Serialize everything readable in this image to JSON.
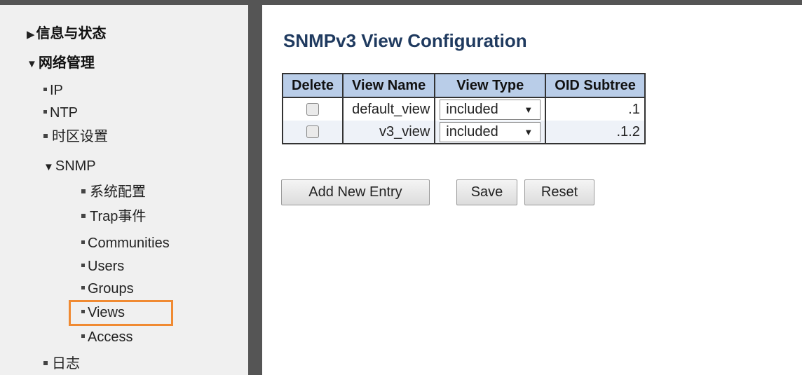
{
  "sidebar": {
    "items": [
      {
        "label": "信息与状态",
        "marker": "▶"
      },
      {
        "label": "网络管理",
        "marker": "▼"
      },
      {
        "label": "IP"
      },
      {
        "label": "NTP"
      },
      {
        "label": "时区设置"
      },
      {
        "label": "SNMP",
        "marker": "▼"
      },
      {
        "label": "系统配置"
      },
      {
        "label": "Trap事件"
      },
      {
        "label": "Communities"
      },
      {
        "label": "Users"
      },
      {
        "label": "Groups"
      },
      {
        "label": "Views",
        "selected": true
      },
      {
        "label": "Access"
      },
      {
        "label": "日志"
      }
    ]
  },
  "main": {
    "title": "SNMPv3 View Configuration",
    "table": {
      "headers": [
        "Delete",
        "View Name",
        "View Type",
        "OID Subtree"
      ],
      "rows": [
        {
          "checked": false,
          "view_name": "default_view",
          "view_type": "included",
          "oid": ".1"
        },
        {
          "checked": false,
          "view_name": "v3_view",
          "view_type": "included",
          "oid": ".1.2"
        }
      ]
    },
    "buttons": {
      "add": "Add New Entry",
      "save": "Save",
      "reset": "Reset"
    }
  },
  "colors": {
    "header_bg": "#b9cde8",
    "title": "#1f3a5f",
    "highlight": "#f08a32",
    "divider": "#555555"
  }
}
